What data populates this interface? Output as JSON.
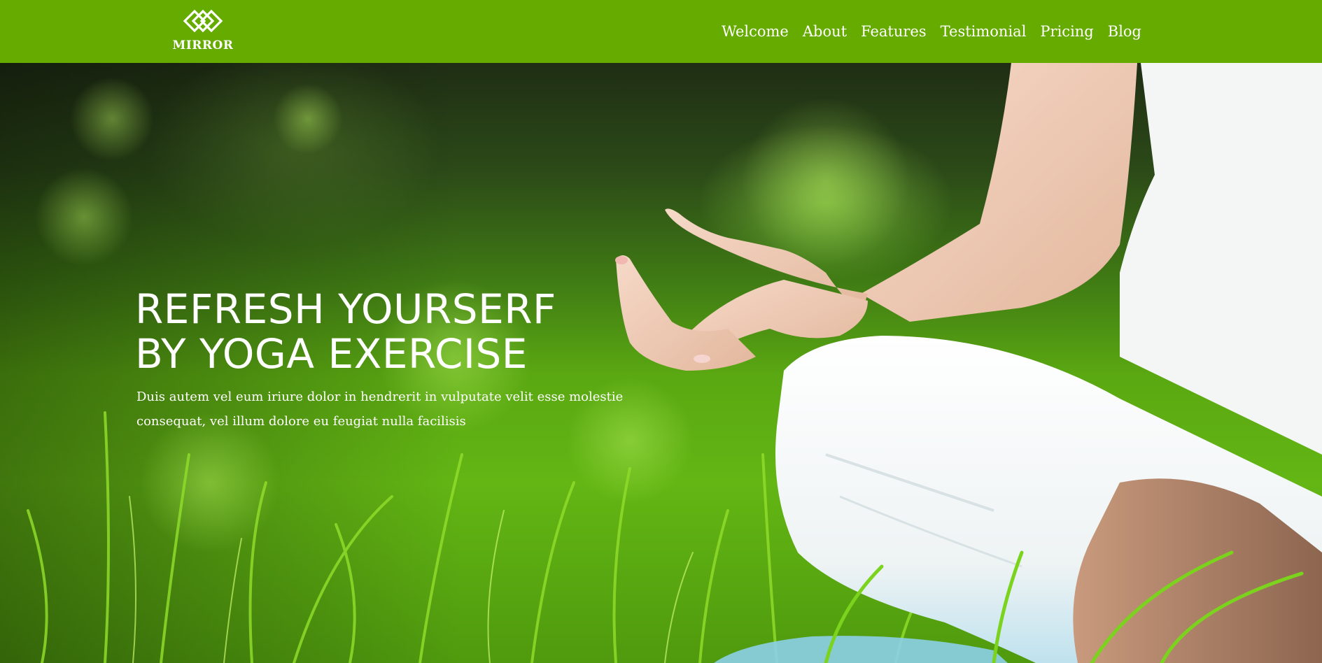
{
  "brand": {
    "name": "MIRROR",
    "logo_icon": "interlocked-diamonds-icon"
  },
  "nav": {
    "items": [
      "Welcome",
      "About",
      "Features",
      "Testimonial",
      "Pricing",
      "Blog"
    ]
  },
  "hero": {
    "heading_line1": "REFRESH YOURSERF",
    "heading_line2": "BY YOGA EXERCISE",
    "subtext": "Duis autem vel eum iriure dolor in hendrerit in vulputate velit esse molestie consequat, vel illum dolore eu feugiat nulla facilisis",
    "image_subject": "person meditating in lotus pose on grass"
  },
  "colors": {
    "navbar_bg": "#66ab00",
    "nav_text": "#ffffff",
    "hero_text": "#ffffff"
  }
}
